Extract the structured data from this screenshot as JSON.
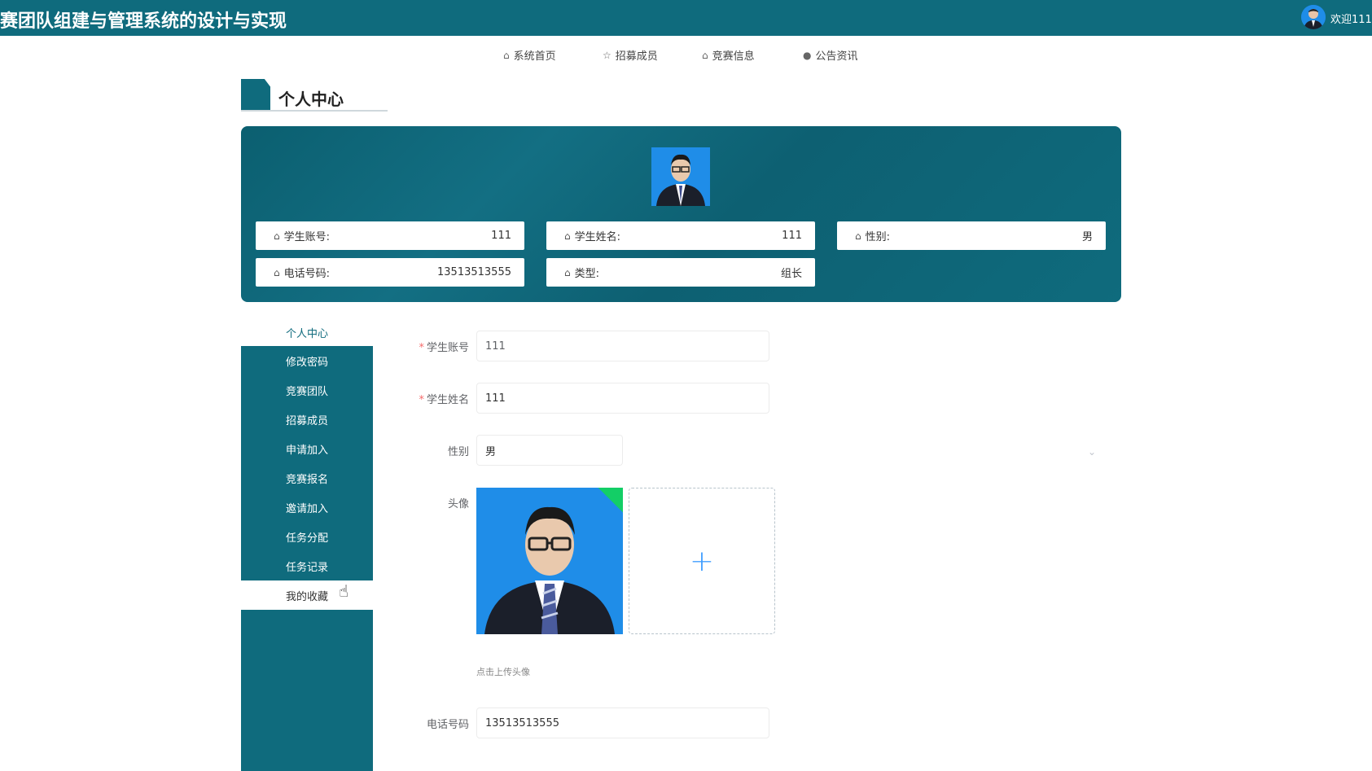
{
  "header": {
    "title": "赛团队组建与管理系统的设计与实现",
    "welcome": "欢迎111"
  },
  "nav": [
    {
      "label": "系统首页",
      "icon": "home-icon"
    },
    {
      "label": "招募成员",
      "icon": "star-icon"
    },
    {
      "label": "竞赛信息",
      "icon": "bag-icon"
    },
    {
      "label": "公告资讯",
      "icon": "info-icon"
    }
  ],
  "section_title": "个人中心",
  "profile": {
    "account_label": "学生账号:",
    "account": "111",
    "name_label": "学生姓名:",
    "name": "111",
    "gender_label": "性别:",
    "gender": "男",
    "phone_label": "电话号码:",
    "phone": "13513513555",
    "type_label": "类型:",
    "type": "组长"
  },
  "sidebar": {
    "active": "个人中心",
    "items": [
      "修改密码",
      "竞赛团队",
      "招募成员",
      "申请加入",
      "竞赛报名",
      "邀请加入",
      "任务分配",
      "任务记录"
    ],
    "favorites": "我的收藏"
  },
  "form": {
    "account_label": "学生账号",
    "account_value": "111",
    "name_label": "学生姓名",
    "name_value": "111",
    "gender_label": "性别",
    "gender_value": "男",
    "avatar_label": "头像",
    "upload_hint": "点击上传头像",
    "phone_label": "电话号码",
    "phone_value": "13513513555"
  },
  "colors": {
    "primary": "#0f6b7d",
    "required": "#f56c6c",
    "success": "#13ce66"
  }
}
